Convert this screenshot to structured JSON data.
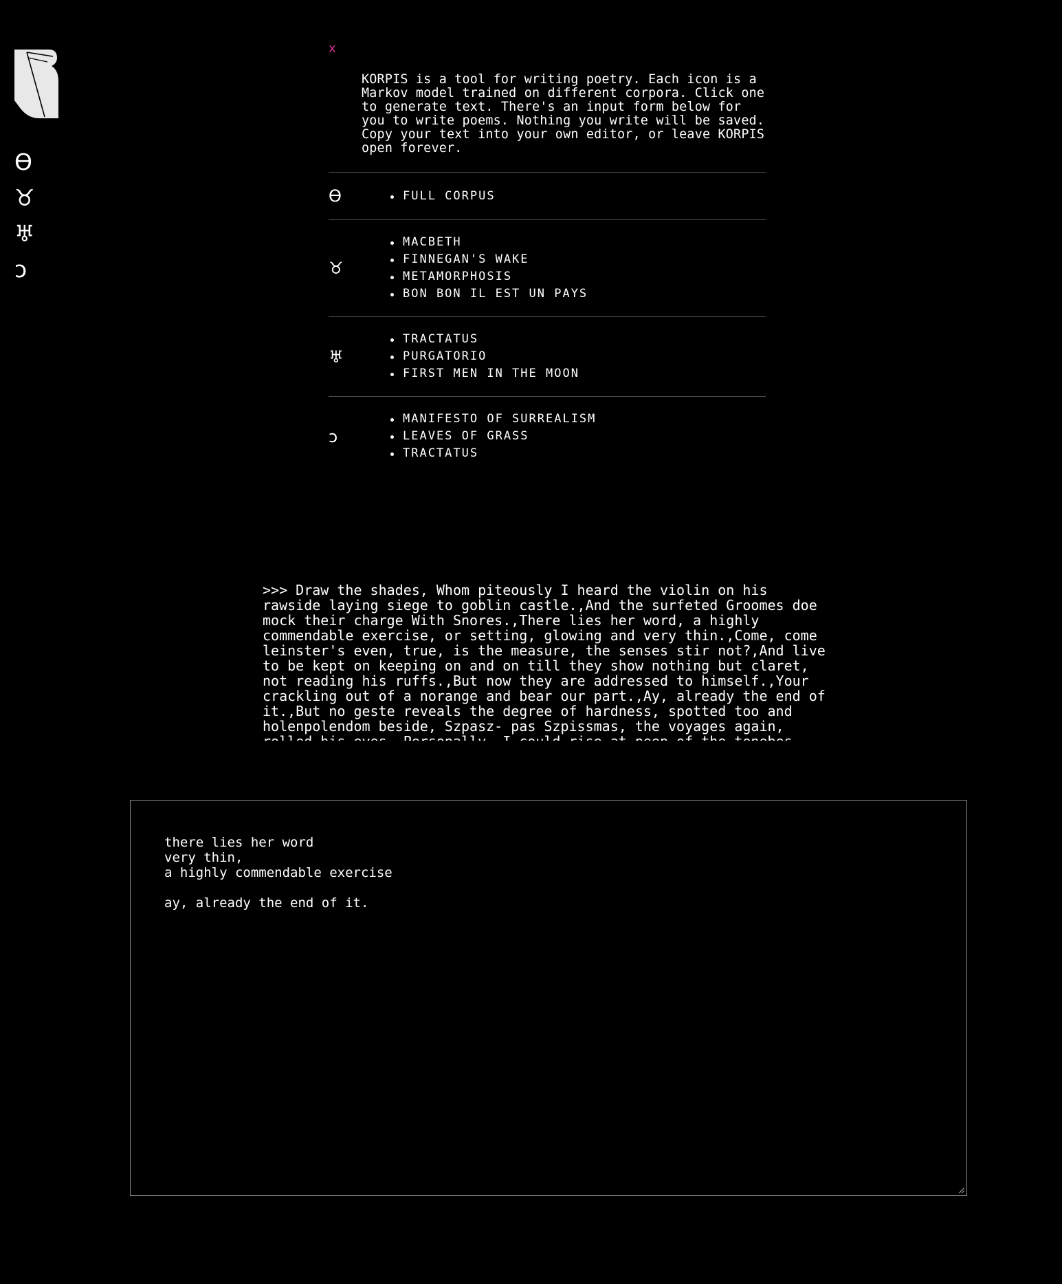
{
  "sidebar": {
    "icons": [
      {
        "name": "theta-icon",
        "glyph": "ϴ"
      },
      {
        "name": "taurus-icon",
        "glyph": "♉"
      },
      {
        "name": "uranus-icon",
        "glyph": "♅"
      },
      {
        "name": "swirl-icon",
        "glyph": "ↄ"
      }
    ]
  },
  "info": {
    "close_label": "x",
    "intro": "KORPIS is a tool for writing poetry. Each icon is a Markov model trained on different corpora. Click one to generate text. There's an input form below for you to write poems. Nothing you write will be saved. Copy your text into your own editor, or leave KORPIS open forever.",
    "groups": [
      {
        "icon": "ϴ",
        "items": [
          "FULL CORPUS"
        ]
      },
      {
        "icon": "♉",
        "items": [
          "MACBETH",
          "FINNEGAN'S WAKE",
          "METAMORPHOSIS",
          "BON BON IL EST UN PAYS"
        ]
      },
      {
        "icon": "♅",
        "items": [
          "TRACTATUS",
          "PURGATORIO",
          "FIRST MEN IN THE MOON"
        ]
      },
      {
        "icon": "ↄ",
        "items": [
          "MANIFESTO OF SURREALISM",
          "LEAVES OF GRASS",
          "TRACTATUS"
        ]
      }
    ]
  },
  "generated_text": ">>> Draw the shades, Whom piteously I heard the violin on his rawside laying siege to goblin castle.,And the surfeted Groomes doe mock their charge With Snores.,There lies her word, a highly commendable exercise, or setting, glowing and very thin.,Come, come leinster's even, true, is the measure, the senses stir not?,And live to be kept on keeping on and on till they show nothing but claret, not reading his ruffs.,But now they are addressed to himself.,Your crackling out of a norange and bear our part.,Ay, already the end of it.,But no geste reveals the degree of hardness, spotted too and holenpolendom beside, Szpasz- pas Szpissmas, the voyages again, rolled his eyes.,Personally, I could rise at peep of the tenebes",
  "editor": {
    "value": "there lies her word\nvery thin,\na highly commendable exercise\n\nay, already the end of it."
  },
  "colors": {
    "background": "#000000",
    "text": "#ffffff",
    "close_accent": "#e0339a",
    "divider": "#4a4a4a"
  }
}
